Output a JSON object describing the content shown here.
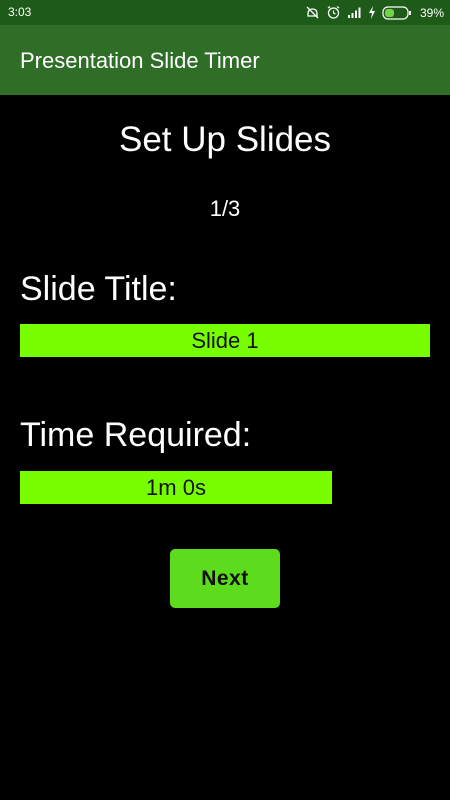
{
  "status_bar": {
    "time": "3:03",
    "battery_percent": "39%",
    "icons": [
      "do-not-disturb-icon",
      "alarm-icon",
      "signal-icon",
      "charging-icon",
      "battery-icon"
    ]
  },
  "app_bar": {
    "title": "Presentation Slide Timer"
  },
  "main": {
    "heading": "Set Up Slides",
    "page_counter": "1/3",
    "slide_title_label": "Slide Title:",
    "slide_title_value": "Slide 1",
    "time_label": "Time Required:",
    "time_value": "1m 0s",
    "next_label": "Next"
  },
  "colors": {
    "status_bar": "#1e5a18",
    "app_bar": "#2f6e27",
    "background": "#000000",
    "field": "#77ff00",
    "button": "#5ddc1d"
  }
}
